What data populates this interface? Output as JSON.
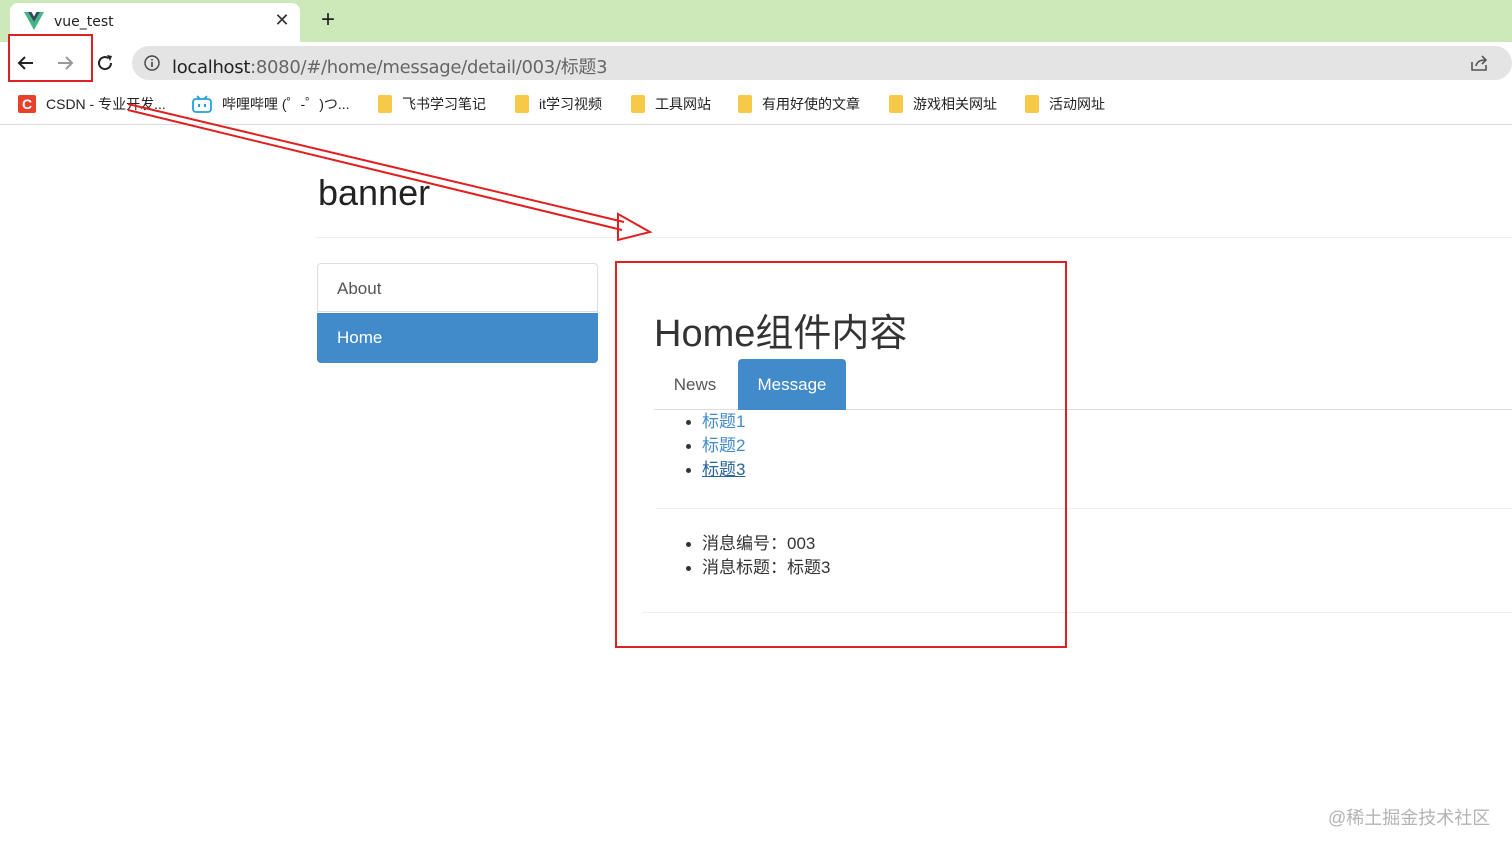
{
  "browser": {
    "tab_title": "vue_test",
    "tab_close": "✕",
    "new_tab": "+",
    "url_host": "localhost",
    "url_path": ":8080/#/home/message/detail/003/标题3"
  },
  "bookmarks": [
    {
      "label": "CSDN - 专业开发...",
      "icon": "csdn-icon"
    },
    {
      "label": "哔哩哔哩 (゜-゜)つ...",
      "icon": "bilibili-icon"
    },
    {
      "label": "飞书学习笔记",
      "icon": "folder-icon"
    },
    {
      "label": "it学习视频",
      "icon": "folder-icon"
    },
    {
      "label": "工具网站",
      "icon": "folder-icon"
    },
    {
      "label": "有用好使的文章",
      "icon": "folder-icon"
    },
    {
      "label": "游戏相关网址",
      "icon": "folder-icon"
    },
    {
      "label": "活动网址",
      "icon": "folder-icon"
    }
  ],
  "page": {
    "banner": "banner",
    "sidenav": {
      "about": "About",
      "home": "Home"
    },
    "home_heading": "Home组件内容",
    "tabs": {
      "news": "News",
      "message": "Message"
    },
    "messages": [
      "标题1",
      "标题2",
      "标题3"
    ],
    "detail": {
      "id_line": "消息编号：003",
      "title_line": "消息标题：标题3"
    }
  },
  "watermark": "@稀土掘金技术社区",
  "colors": {
    "tabstrip": "#cde8b9",
    "primary": "#428bca",
    "annotation": "#e02020"
  }
}
